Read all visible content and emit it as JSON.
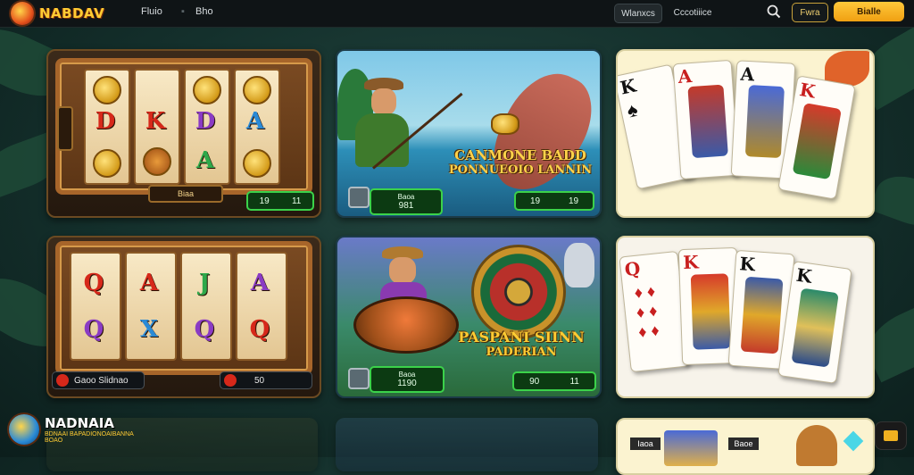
{
  "header": {
    "logo_text": "NABDAV",
    "nav": [
      "Fluio",
      "Bho"
    ],
    "pills": [
      "Wlanxcs",
      "Cccotiiice"
    ],
    "login_label": "Fwra",
    "register_label": "Bialle"
  },
  "cards": {
    "slot1": {
      "reel_symbols": [
        "D",
        "K",
        "D",
        "A",
        "A"
      ],
      "plaque": "Biaa",
      "win_left": "19",
      "win_right": "11"
    },
    "fish": {
      "title_line1": "CANMONE BADD",
      "title_line2": "PONNUEOIO LANNIN",
      "bar_label": "Baoa",
      "bar_value": "981",
      "win_left": "19",
      "win_right": "19"
    },
    "slot2": {
      "reel_symbols": [
        "Q",
        "A",
        "J",
        "A",
        "Q",
        "X",
        "Q",
        "Q"
      ],
      "label": "Gaoo Slidnao",
      "value": "50"
    },
    "roulette": {
      "title_line1": "PASPANI SIINN",
      "title_line2": "PADERIAN",
      "bar_label": "Baoa",
      "bar_value": "1190",
      "win_left": "90",
      "win_right": "11"
    },
    "cards1": {
      "letters": [
        "K",
        "A",
        "A",
        "K"
      ]
    },
    "cards2": {
      "letters": [
        "Q",
        "K",
        "K",
        "K"
      ]
    },
    "bottom": {
      "tags": [
        "Iaoa",
        "Baoe"
      ]
    }
  },
  "footer_logo": {
    "title": "NADNAIA",
    "line2": "BDNAAI BAPADIONOAIBANNA",
    "line3": "BOAO"
  },
  "colors": {
    "accent": "#f0a012",
    "win_green": "#3bd24a",
    "header_bg": "#0f1416"
  },
  "icons": [
    "search-icon",
    "chat-icon",
    "slot-icon"
  ]
}
